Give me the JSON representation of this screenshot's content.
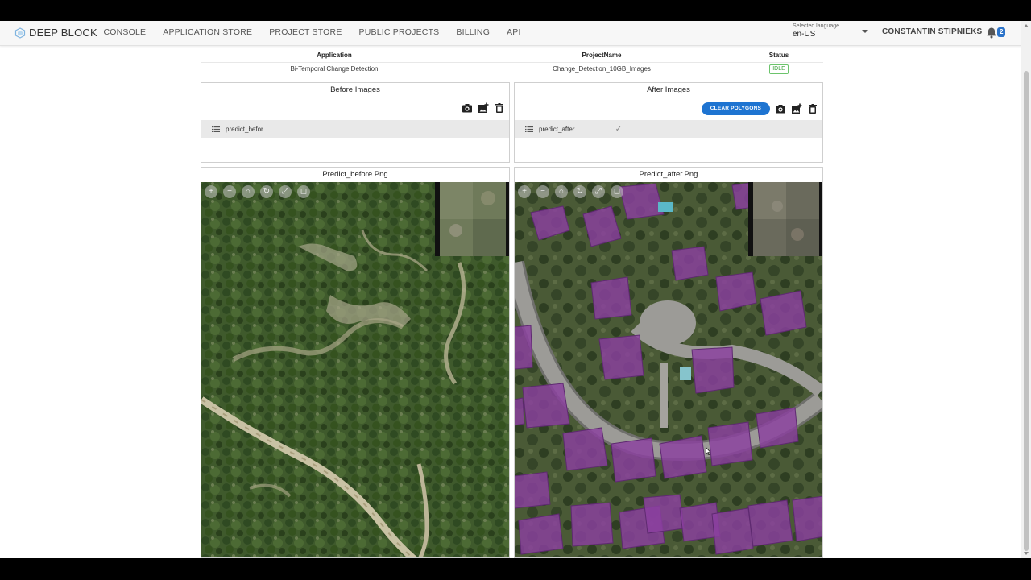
{
  "nav": {
    "logo_text": "DEEP BLOCK",
    "links": [
      "CONSOLE",
      "APPLICATION STORE",
      "PROJECT STORE",
      "PUBLIC PROJECTS",
      "BILLING",
      "API"
    ],
    "language_caption": "Selected language",
    "language_value": "en-US",
    "user_name": "CONSTANTIN STIPNIEKS",
    "notification_count": "2"
  },
  "project": {
    "headers": {
      "application": "Application",
      "project_name": "ProjectName",
      "status": "Status"
    },
    "application": "Bi-Temporal Change Detection",
    "project_name": "Change_Detection_10GB_Images",
    "status": "IDLE"
  },
  "before_panel": {
    "title": "Before Images",
    "file": "predict_befor..."
  },
  "after_panel": {
    "title": "After Images",
    "clear_button": "CLEAR POLYGONS",
    "file": "predict_after..."
  },
  "viewers": {
    "before_title": "Predict_before.Png",
    "after_title": "Predict_after.Png",
    "zoom_in": "+",
    "zoom_out": "−"
  },
  "colors": {
    "accent": "#1e74d1",
    "status_idle": "#3aa03a",
    "polygon_fill": "#8b3fa0"
  },
  "icons": [
    "logo-icon",
    "bell-icon",
    "camera-icon",
    "add-image-icon",
    "trash-icon",
    "list-icon",
    "check-icon"
  ]
}
